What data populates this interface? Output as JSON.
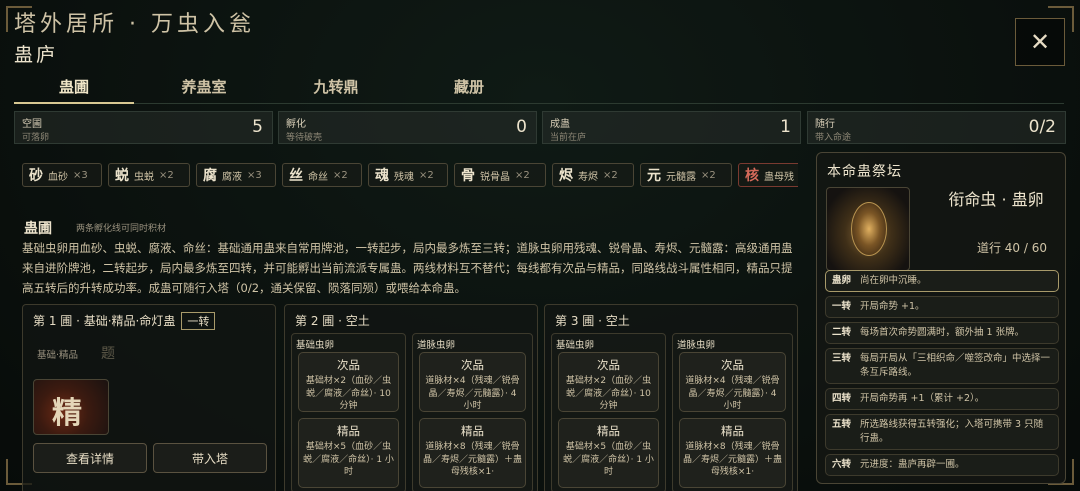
{
  "header": {
    "title": "塔外居所 · 万虫入瓮",
    "subtitle": "蛊庐",
    "close_label": "✕"
  },
  "tabs": [
    {
      "label": "蛊圃",
      "active": true
    },
    {
      "label": "养蛊室",
      "active": false
    },
    {
      "label": "九转鼎",
      "active": false
    },
    {
      "label": "藏册",
      "active": false
    }
  ],
  "stats": [
    {
      "label": "空圃",
      "sub": "可落卵",
      "value": "5"
    },
    {
      "label": "孵化",
      "sub": "等待破壳",
      "value": "0"
    },
    {
      "label": "成蛊",
      "sub": "当前在庐",
      "value": "1"
    },
    {
      "label": "随行",
      "sub": "带入命途",
      "value": "0/2"
    }
  ],
  "materials": [
    {
      "glyph": "砂",
      "name": "血砂",
      "count": "×3"
    },
    {
      "glyph": "蜕",
      "name": "虫蜕",
      "count": "×2"
    },
    {
      "glyph": "腐",
      "name": "腐液",
      "count": "×3"
    },
    {
      "glyph": "丝",
      "name": "命丝",
      "count": "×2"
    },
    {
      "glyph": "魂",
      "name": "残魂",
      "count": "×2"
    },
    {
      "glyph": "骨",
      "name": "锐骨晶",
      "count": "×2"
    },
    {
      "glyph": "烬",
      "name": "寿烬",
      "count": "×2"
    },
    {
      "glyph": "元",
      "name": "元髓露",
      "count": "×2"
    },
    {
      "glyph": "核",
      "name": "蛊母残",
      "count": ""
    }
  ],
  "garden": {
    "heading": "蛊圃",
    "note": "两条孵化线可同时积材",
    "description": "基础虫卵用血砂、虫蜕、腐液、命丝：基础通用蛊来自常用牌池，一转起步，局内最多炼至三转；道脉虫卵用残魂、锐骨晶、寿烬、元髓露：高级通用蛊来自进阶牌池，二转起步，局内最多炼至四转，并可能孵出当前流派专属蛊。两线材料互不替代；每线都有次品与精品，同路线战斗属性相同，精品只提高五转后的升转成功率。成蛊可随行入塔（0/2，通关保留、陨落同殒）或喂给本命蛊。"
  },
  "plot1": {
    "title": "第 1 圃 · 基础·精品·命灯蛊",
    "tier": "一转",
    "base_label": "基础·精品",
    "base_glyph": "题",
    "egg_glyph": "精",
    "detail_button": "查看详情",
    "take_button": "带入塔"
  },
  "plot2": {
    "title": "第 2 圃 · 空土",
    "basic_head": "基础虫卵",
    "dao_head": "道脉虫卵",
    "basic_cards": [
      {
        "title": "次品",
        "body": "基础材×2（血砂／虫蜕／腐液／命丝）· 10 分钟"
      },
      {
        "title": "精品",
        "body": "基础材×5（血砂／虫蜕／腐液／命丝）· 1 小时"
      }
    ],
    "dao_cards": [
      {
        "title": "次品",
        "body": "道脉材×4（残魂／锐骨晶／寿烬／元髓露）· 4 小时"
      },
      {
        "title": "精品",
        "body": "道脉材×8（残魂／锐骨晶／寿烬／元髓露）＋蛊母残核×1·"
      }
    ]
  },
  "plot3": {
    "title": "第 3 圃 · 空土",
    "basic_head": "基础虫卵",
    "dao_head": "道脉虫卵",
    "basic_cards": [
      {
        "title": "次品",
        "body": "基础材×2（血砂／虫蜕／腐液／命丝）· 10 分钟"
      },
      {
        "title": "精品",
        "body": "基础材×5（血砂／虫蜕／腐液／命丝）· 1 小时"
      }
    ],
    "dao_cards": [
      {
        "title": "次品",
        "body": "道脉材×4（残魂／锐骨晶／寿烬／元髓露）· 4 小时"
      },
      {
        "title": "精品",
        "body": "道脉材×8（残魂／锐骨晶／寿烬／元髓露）＋蛊母残核×1·"
      }
    ]
  },
  "altar": {
    "title": "本命蛊祭坛",
    "name": "衔命虫 · 蛊卵",
    "path": "道行 40 / 60",
    "turns": [
      {
        "key": "蛊卵",
        "text": "尚在卵中沉睡。",
        "active": true
      },
      {
        "key": "一转",
        "text": "开局命势 +1。",
        "active": false
      },
      {
        "key": "二转",
        "text": "每场首次命势圆满时，额外抽 1 张牌。",
        "active": false
      },
      {
        "key": "三转",
        "text": "每局开局从「三相织命／噬签改命」中选择一条互斥路线。",
        "active": false
      },
      {
        "key": "四转",
        "text": "开局命势再 +1（累计 +2）。",
        "active": false
      },
      {
        "key": "五转",
        "text": "所选路线获得五转强化；入塔可携带 3 只随行蛊。",
        "active": false
      },
      {
        "key": "六转",
        "text": "元进度：蛊庐再辟一圃。",
        "active": false
      }
    ]
  },
  "colors": {
    "accent": "#d8c892",
    "background": "#0b110e",
    "panel_border": "#4a4535",
    "danger": "#d46a5a"
  }
}
